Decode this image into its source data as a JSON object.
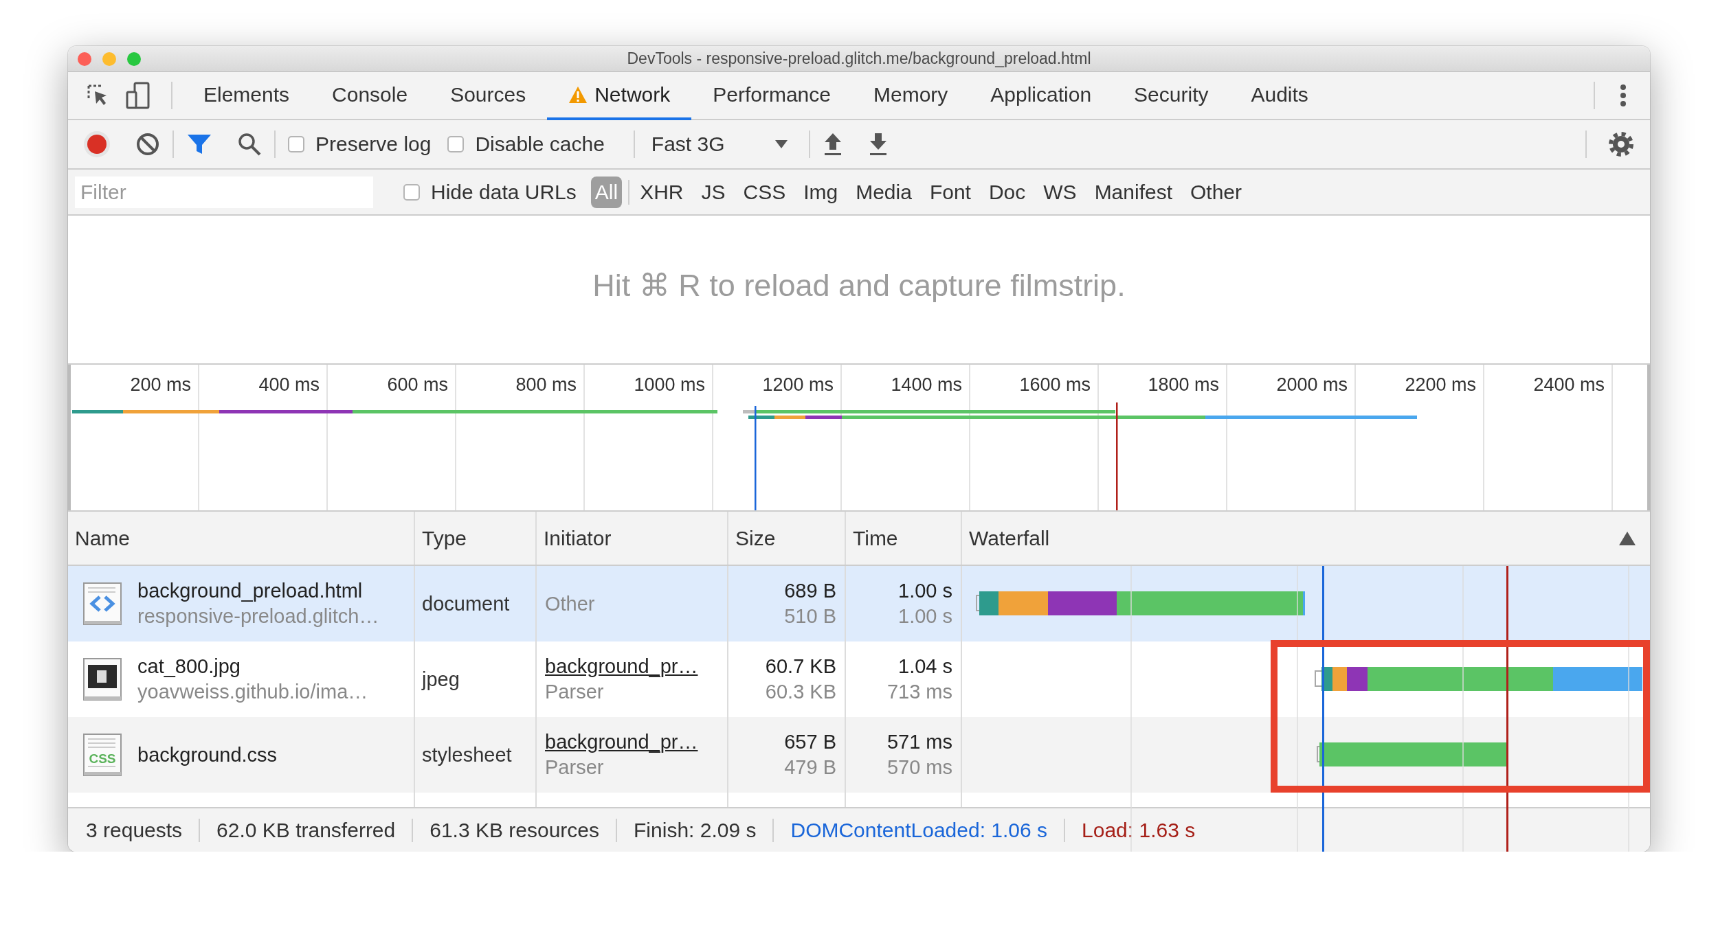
{
  "window": {
    "title": "DevTools - responsive-preload.glitch.me/background_preload.html"
  },
  "panel_tabs": [
    {
      "label": "Elements",
      "selected": false,
      "warning": false
    },
    {
      "label": "Console",
      "selected": false,
      "warning": false
    },
    {
      "label": "Sources",
      "selected": false,
      "warning": false
    },
    {
      "label": "Network",
      "selected": true,
      "warning": true
    },
    {
      "label": "Performance",
      "selected": false,
      "warning": false
    },
    {
      "label": "Memory",
      "selected": false,
      "warning": false
    },
    {
      "label": "Application",
      "selected": false,
      "warning": false
    },
    {
      "label": "Security",
      "selected": false,
      "warning": false
    },
    {
      "label": "Audits",
      "selected": false,
      "warning": false
    }
  ],
  "toolbar": {
    "recording": true,
    "filter_active": true,
    "preserve_log": {
      "label": "Preserve log",
      "checked": false
    },
    "disable_cache": {
      "label": "Disable cache",
      "checked": false
    },
    "throttling": "Fast 3G"
  },
  "filter_bar": {
    "placeholder": "Filter",
    "hide_data_urls": {
      "label": "Hide data URLs",
      "checked": false
    },
    "types": [
      {
        "label": "All",
        "selected": true
      },
      {
        "label": "XHR",
        "selected": false
      },
      {
        "label": "JS",
        "selected": false
      },
      {
        "label": "CSS",
        "selected": false
      },
      {
        "label": "Img",
        "selected": false
      },
      {
        "label": "Media",
        "selected": false
      },
      {
        "label": "Font",
        "selected": false
      },
      {
        "label": "Doc",
        "selected": false
      },
      {
        "label": "WS",
        "selected": false
      },
      {
        "label": "Manifest",
        "selected": false
      },
      {
        "label": "Other",
        "selected": false
      }
    ]
  },
  "filmstrip": {
    "message": "Hit ⌘ R to reload and capture filmstrip."
  },
  "overview": {
    "ticks": [
      "200 ms",
      "400 ms",
      "600 ms",
      "800 ms",
      "1000 ms",
      "1200 ms",
      "1400 ms",
      "1600 ms",
      "1800 ms",
      "2000 ms",
      "2200 ms",
      "2400 ms"
    ]
  },
  "table": {
    "columns": [
      "Name",
      "Type",
      "Initiator",
      "Size",
      "Time",
      "Waterfall"
    ],
    "rows": [
      {
        "kind": "document",
        "selected": true,
        "name": "background_preload.html",
        "url": "responsive-preload.glitch…",
        "type": "document",
        "initiator": "Other",
        "initiator_link": false,
        "size": "689 B",
        "resource_size": "510 B",
        "time": "1.00 s",
        "latency": "1.00 s"
      },
      {
        "kind": "image",
        "selected": false,
        "name": "cat_800.jpg",
        "url": "yoavweiss.github.io/ima…",
        "type": "jpeg",
        "initiator": "background_pr…",
        "initiator_link": true,
        "initiator_detail": "Parser",
        "size": "60.7 KB",
        "resource_size": "60.3 KB",
        "time": "1.04 s",
        "latency": "713 ms"
      },
      {
        "kind": "stylesheet",
        "selected": false,
        "icon_text": "CSS",
        "name": "background.css",
        "type": "stylesheet",
        "initiator": "background_pr…",
        "initiator_link": true,
        "initiator_detail": "Parser",
        "size": "657 B",
        "resource_size": "479 B",
        "time": "571 ms",
        "latency": "570 ms"
      }
    ]
  },
  "status_bar": [
    {
      "kind": "plain",
      "text": "3 requests"
    },
    {
      "kind": "plain",
      "text": "62.0 KB transferred"
    },
    {
      "kind": "plain",
      "text": "61.3 KB resources"
    },
    {
      "kind": "plain",
      "text": "Finish: 2.09 s"
    },
    {
      "kind": "dom",
      "text": "DOMContentLoaded: 1.06 s"
    },
    {
      "kind": "load",
      "text": "Load: 1.63 s"
    }
  ]
}
